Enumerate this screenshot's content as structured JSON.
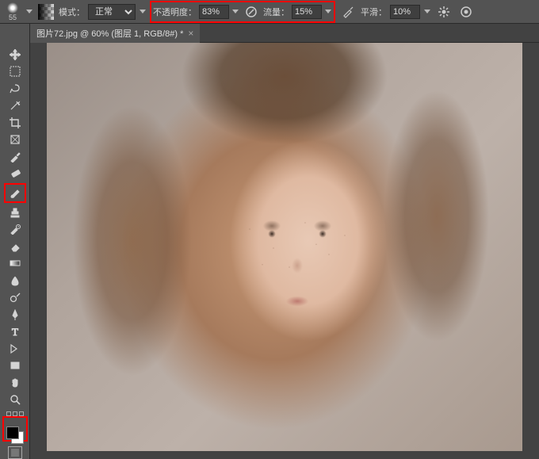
{
  "options": {
    "brush_size": "55",
    "mode_label": "模式：",
    "mode_value": "正常",
    "opacity_label": "不透明度：",
    "opacity_value": "83%",
    "flow_label": "流量：",
    "flow_value": "15%",
    "smoothing_label": "平滑：",
    "smoothing_value": "10%"
  },
  "tab": {
    "title": "图片72.jpg @ 60% (图层 1, RGB/8#) *",
    "close": "×"
  },
  "tools": {
    "move": "move-tool",
    "marquee": "marquee-tool",
    "lasso": "lasso-tool",
    "wand": "wand-tool",
    "crop": "crop-tool",
    "frame": "frame-tool",
    "eyedropper": "eyedropper-tool",
    "heal": "heal-tool",
    "brush": "brush-tool",
    "stamp": "stamp-tool",
    "history": "history-brush-tool",
    "eraser": "eraser-tool",
    "gradient": "gradient-tool",
    "blur": "blur-tool",
    "dodge": "dodge-tool",
    "pen": "pen-tool",
    "type": "type-tool",
    "path": "path-tool",
    "shape": "shape-tool",
    "hand": "hand-tool",
    "zoom": "zoom-tool"
  },
  "colors": {
    "fg": "#000000",
    "bg": "#ffffff"
  }
}
